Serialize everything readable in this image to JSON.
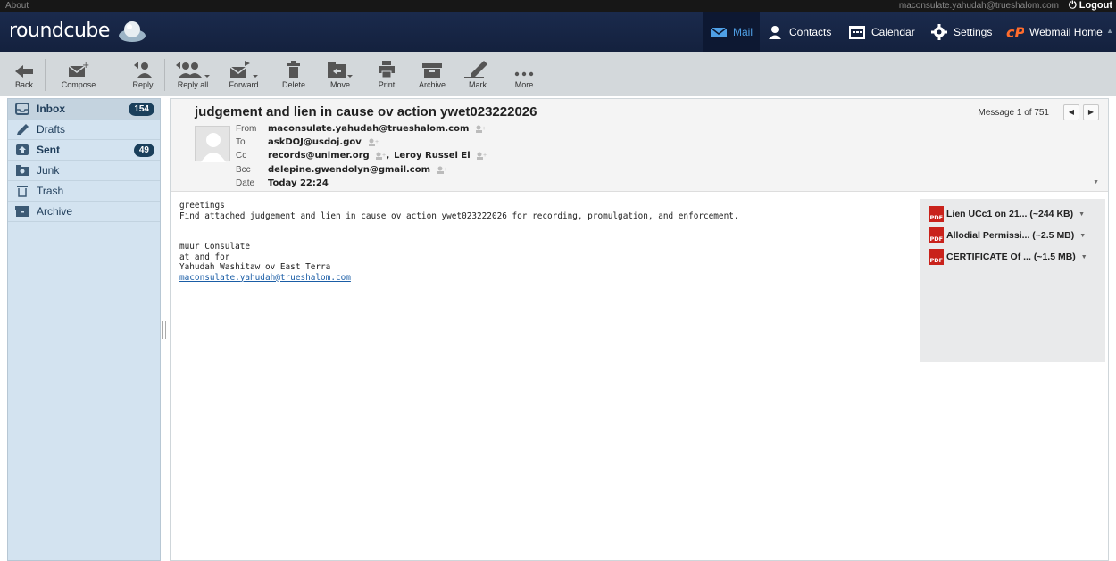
{
  "topbar": {
    "about": "About",
    "user": "maconsulate.yahudah@trueshalom.com",
    "logout": "Logout"
  },
  "header": {
    "logo": "roundcube",
    "nav": [
      {
        "label": "Mail",
        "icon": "mail-icon"
      },
      {
        "label": "Contacts",
        "icon": "contacts-icon"
      },
      {
        "label": "Calendar",
        "icon": "calendar-icon"
      },
      {
        "label": "Settings",
        "icon": "gear-icon"
      },
      {
        "label": "Webmail Home",
        "icon": "cpanel-icon"
      }
    ]
  },
  "toolbar": {
    "back": "Back",
    "compose": "Compose",
    "reply": "Reply",
    "reply_all": "Reply all",
    "forward": "Forward",
    "delete": "Delete",
    "move": "Move",
    "print": "Print",
    "archive": "Archive",
    "mark": "Mark",
    "more": "More"
  },
  "folders": [
    {
      "name": "Inbox",
      "count": "154",
      "icon": "inbox-icon"
    },
    {
      "name": "Drafts",
      "count": "",
      "icon": "pencil-icon"
    },
    {
      "name": "Sent",
      "count": "49",
      "icon": "sent-icon"
    },
    {
      "name": "Junk",
      "count": "",
      "icon": "junk-icon"
    },
    {
      "name": "Trash",
      "count": "",
      "icon": "trash-icon"
    },
    {
      "name": "Archive",
      "count": "",
      "icon": "archive-icon"
    }
  ],
  "message": {
    "subject": "judgement and lien in cause ov action ywet023222026",
    "counter": "Message 1 of 751",
    "from_label": "From",
    "from": "maconsulate.yahudah@trueshalom.com",
    "to_label": "To",
    "to": "askDOJ@usdoj.gov",
    "cc_label": "Cc",
    "cc1": "records@unimer.org",
    "cc_sep": ",",
    "cc2": "Leroy Russel El",
    "bcc_label": "Bcc",
    "bcc": "delepine.gwendolyn@gmail.com",
    "date_label": "Date",
    "date": "Today 22:24",
    "body_line1": "greetings",
    "body_line2": "Find attached judgement and lien in cause ov action ywet023222026 for recording, promulgation, and enforcement.",
    "sig1": "muur Consulate",
    "sig2": "at and for",
    "sig3": "Yahudah Washitaw ov East Terra",
    "sig_link": "maconsulate.yahudah@trueshalom.com"
  },
  "attachments": [
    {
      "name": "Lien UCc1 on 21...",
      "size": "(~244 KB)"
    },
    {
      "name": "Allodial Permissi...",
      "size": "(~2.5 MB)"
    },
    {
      "name": "CERTIFICATE Of ...",
      "size": "(~1.5 MB)"
    }
  ],
  "colors": {
    "header": "#14213e",
    "toolbar": "#d3d8db",
    "sidebar": "#d3e3f0",
    "accent": "#4fa0e6",
    "count_badge": "#1a3f5b"
  }
}
